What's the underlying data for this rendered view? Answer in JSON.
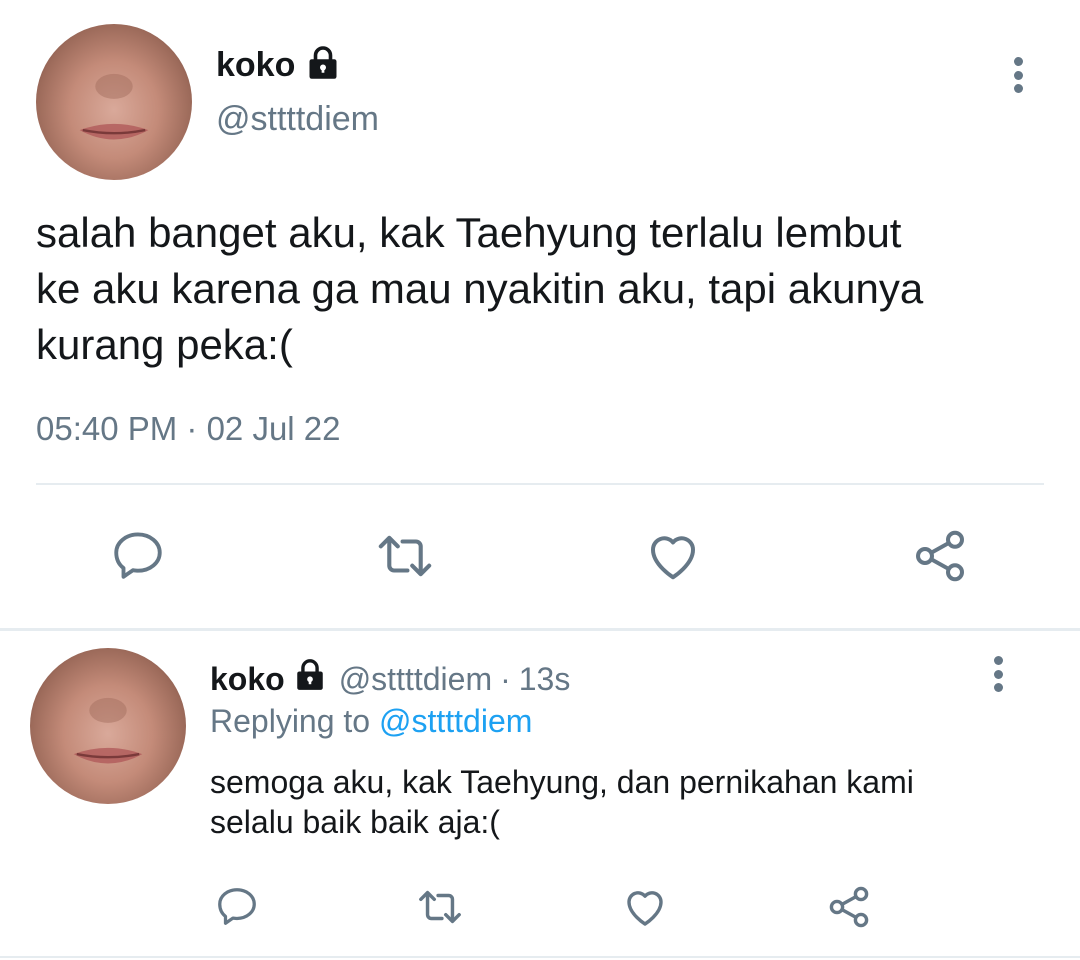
{
  "main_tweet": {
    "display_name": "koko",
    "handle": "@sttttdiem",
    "text_lines": [
      "salah banget aku, kak Taehyung terlalu lembut",
      "ke aku karena ga mau nyakitin aku, tapi akunya",
      "kurang peka:("
    ],
    "timestamp": "05:40 PM · 02 Jul 22",
    "actions": [
      "reply-icon",
      "retweet-icon",
      "like-icon",
      "share-icon"
    ]
  },
  "reply_tweet": {
    "display_name": "koko",
    "handle": "@sttttdiem",
    "time_sep": "·",
    "time_ago": "13s",
    "replying_prefix": "Replying to",
    "replying_handle": "@sttttdiem",
    "text_lines": [
      "semoga aku, kak Taehyung, dan pernikahan kami",
      "selalu baik baik aja:("
    ],
    "actions": [
      "reply-icon",
      "retweet-icon",
      "like-icon",
      "share-icon"
    ]
  },
  "colors": {
    "text_primary": "#14171a",
    "text_secondary": "#657786",
    "link": "#1da1f2",
    "divider": "#e6ecf0",
    "icon": "#657786"
  }
}
